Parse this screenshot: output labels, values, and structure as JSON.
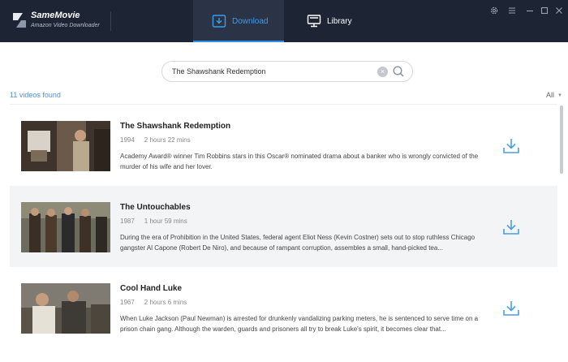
{
  "app": {
    "name": "SameMovie",
    "subtitle": "Amazon Video Downloader"
  },
  "nav": {
    "download_label": "Download",
    "library_label": "Library"
  },
  "search": {
    "value": "The Shawshank Redemption"
  },
  "results": {
    "count_label": "11 videos found",
    "filter_label": "All",
    "items": [
      {
        "title": "The Shawshank Redemption",
        "year": "1994",
        "duration": "2 hours 22 mins",
        "description": "Academy Award® winner Tim Robbins stars in this Oscar® nominated drama about a banker who is wrongly convicted of the murder of his wife and her lover."
      },
      {
        "title": "The Untouchables",
        "year": "1987",
        "duration": "1 hour 59 mins",
        "description": "During the era of Prohibition in the United States, federal agent Eliot Ness (Kevin Costner) sets out to stop ruthless Chicago gangster Al Capone (Robert De Niro), and because of rampant corruption, assembles a small, hand-picked tea..."
      },
      {
        "title": "Cool Hand Luke",
        "year": "1967",
        "duration": "2 hours 6 mins",
        "description": "When Luke Jackson (Paul Newman) is arrested for drunkenly vandalizing parking meters, he is sentenced to serve time on a prison chain gang. Although the warden, guards and prisoners all try to break Luke's spirit, it becomes clear that..."
      }
    ]
  },
  "colors": {
    "titlebar": "#1d2433",
    "active_tab": "#2b3446",
    "accent": "#2f8fe0",
    "download_icon": "#4a9fe0"
  }
}
